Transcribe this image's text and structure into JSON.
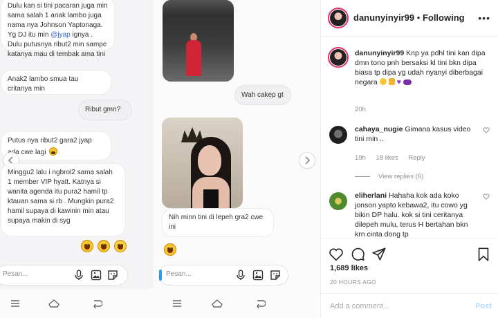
{
  "left_chat": {
    "messages": [
      {
        "text": "Dulu kan si tini pacaran juga min sama salah 1 anak lambo juga nama nya Johnson Yaptonaga. Yg DJ itu min "
      },
      {
        "text": "Anak2 lambo smua tau critanya min"
      },
      {
        "text": "Ribut gmn?"
      },
      {
        "text": "Putus nya ribut2 gara2 jyap ada cwe lagi"
      },
      {
        "text": "Minggu2 lalu i ngbrol2 sama salah 1 member VIP hyatt. Katnya si wanita agenda itu pura2 hamil tp ktauan sama si rb . Mungkin pura2 hamil supaya di kawinin min atau supaya makin di syg"
      }
    ],
    "mention": "@jyap",
    "mention_after": "ignya . Dulu putusnya ribut2 min sampe katanya mau di tembak ama tini",
    "composer_placeholder": "Pesan..."
  },
  "right_chat": {
    "messages": [
      {
        "text": "Wah cakep gt"
      },
      {
        "text": "Nih minn tini di lepeh gra2 cwe ini"
      }
    ],
    "composer_placeholder": "Pesan..."
  },
  "post": {
    "username": "danunyinyir99",
    "follow_label": "Following",
    "caption_username": "danunyinyir99",
    "caption_text": "Knp ya pdhl tini kan dipa dmn tono pnh bersaksi kl tini bkn dipa biasa tp dipa yg udah nyanyi diberbagai negara",
    "caption_time": "20h",
    "comments": [
      {
        "user": "cahaya_nugie",
        "text": "Gimana kasus video tini min ..",
        "time": "19h",
        "likes": "18 likes",
        "reply": "Reply",
        "view_replies": "View replies (6)"
      },
      {
        "user": "eliherlani",
        "text": "Hahaha kok ada koko jonson yapto kebawa2, itu cowo yg bikin DP halu. kok si tini ceritanya dilepeh mulu, terus H bertahan bkn krn cinta dong tp"
      }
    ],
    "likes_count": "1,689 likes",
    "time_ago": "20 HOURS AGO",
    "add_comment_placeholder": "Add a comment...",
    "post_label": "Post"
  },
  "colors": {
    "accent_blue": "#0095f6",
    "post_disabled": "#b3dbff",
    "emoji_yellow": "#f7c531"
  }
}
